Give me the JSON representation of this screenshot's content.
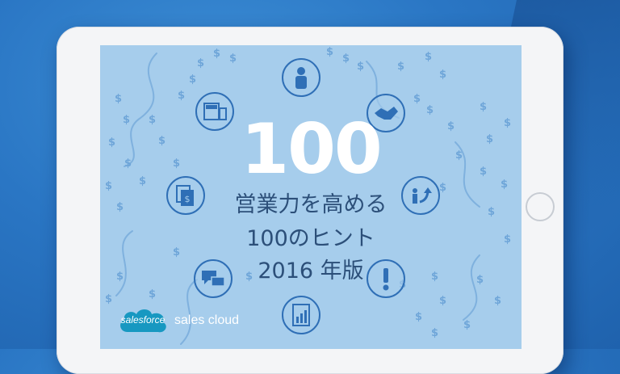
{
  "cover": {
    "number": "100",
    "line1": "営業力を高める",
    "line2": "100のヒント",
    "line3": "2016 年版"
  },
  "brand": {
    "logo_text": "salesforce",
    "product": "sales cloud"
  },
  "colors": {
    "background": "#2a76c4",
    "screen": "#a6cdec",
    "icon_stroke": "#2f6fb6",
    "title_white": "#ffffff",
    "subtitle": "#2c4f79",
    "logo_blue": "#1798c1"
  },
  "icons": [
    "person-icon",
    "devices-icon",
    "handshake-icon",
    "documents-dollar-icon",
    "growth-arrow-icon",
    "chat-bubbles-icon",
    "exclamation-icon",
    "report-chart-icon"
  ]
}
